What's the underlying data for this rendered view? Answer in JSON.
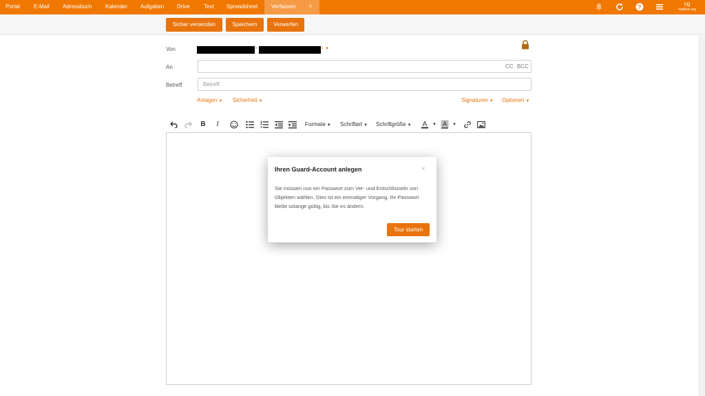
{
  "nav": {
    "items": [
      "Portal",
      "E-Mail",
      "Adressbuch",
      "Kalender",
      "Aufgaben",
      "Drive",
      "Text",
      "Spreadsheet",
      "Verfassen"
    ],
    "active": "Verfassen",
    "close_glyph": "×"
  },
  "top_icons": [
    "bell-icon",
    "refresh-icon",
    "help-icon",
    "menu-icon"
  ],
  "brand": {
    "mark": "cg",
    "name": "mailbox.org"
  },
  "actions": {
    "send_secure": "Sicher versenden",
    "save": "Speichern",
    "discard": "Verwerfen"
  },
  "form": {
    "from_label": "Von",
    "to_label": "An",
    "subject_label": "Betreff",
    "subject_placeholder": "Betreff",
    "cc": "CC",
    "bcc": "BCC",
    "attachments": "Anlagen",
    "security": "Sicherheit",
    "signatures": "Signaturen",
    "options": "Optionen"
  },
  "editor_toolbar": {
    "formats": "Formate",
    "font": "Schriftart",
    "font_size": "Schriftgröße"
  },
  "modal": {
    "title": "Ihren Guard-Account anlegen",
    "close": "×",
    "body": "Sie müssen nun ein Passwort zum Ver- und Entschlüsseln von Objekten wählen. Dies ist ein einmaliger Vorgang. Ihr Passwort bleibt solange gültig, bis Sie es ändern.",
    "button": "Tour starten"
  },
  "colors": {
    "accent": "#f07800",
    "button": "#e9730c",
    "active_tab": "#f59a45"
  }
}
